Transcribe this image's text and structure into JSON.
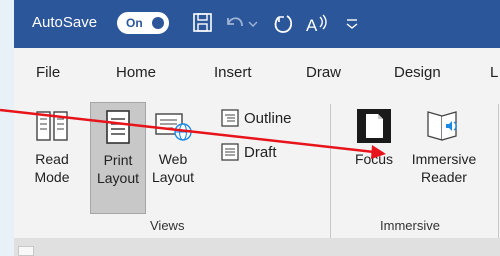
{
  "titlebar": {
    "autosave_label": "AutoSave",
    "toggle_label": "On"
  },
  "menu": {
    "tabs": [
      "File",
      "Home",
      "Insert",
      "Draw",
      "Design",
      "L"
    ]
  },
  "ribbon": {
    "views": {
      "read_mode": [
        "Read",
        "Mode"
      ],
      "print_layout": [
        "Print",
        "Layout"
      ],
      "web_layout": [
        "Web",
        "Layout"
      ],
      "outline": "Outline",
      "draft": "Draft",
      "group_label": "Views"
    },
    "immersive": {
      "focus": "Focus",
      "immersive_reader": [
        "Immersive",
        "Reader"
      ],
      "group_label": "Immersive"
    }
  },
  "colors": {
    "title_bar": "#2b579a",
    "ribbon_bg": "#f3f3f3",
    "annotation_arrow": "#e8141b"
  }
}
